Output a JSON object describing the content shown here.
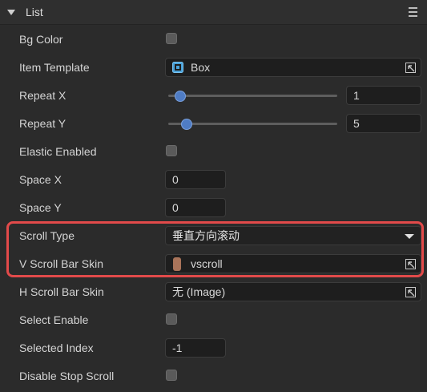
{
  "panel": {
    "title": "List"
  },
  "rows": {
    "bg_color": {
      "label": "Bg Color"
    },
    "item_template": {
      "label": "Item Template",
      "value": "Box"
    },
    "repeat_x": {
      "label": "Repeat X",
      "value": "1",
      "slider_level": 0.05
    },
    "repeat_y": {
      "label": "Repeat Y",
      "value": "5",
      "slider_level": 0.09
    },
    "elastic_enabled": {
      "label": "Elastic Enabled"
    },
    "space_x": {
      "label": "Space X",
      "value": "0"
    },
    "space_y": {
      "label": "Space Y",
      "value": "0"
    },
    "scroll_type": {
      "label": "Scroll Type",
      "value": "垂直方向滚动"
    },
    "v_scroll_bar_skin": {
      "label": "V Scroll Bar Skin",
      "value": "vscroll"
    },
    "h_scroll_bar_skin": {
      "label": "H Scroll Bar Skin",
      "value": "无 (Image)"
    },
    "select_enable": {
      "label": "Select Enable"
    },
    "selected_index": {
      "label": "Selected Index",
      "value": "-1"
    },
    "disable_stop_scroll": {
      "label": "Disable Stop Scroll"
    }
  },
  "colors": {
    "panel_bg": "#2b2b2b",
    "slider_thumb": "#4f7cc4",
    "highlight_border": "#e24a4a",
    "vscroll_swatch": "#a9745a"
  },
  "icons": {
    "collapse": "caret-down-icon",
    "menu": "hamburger-menu-icon",
    "picker": "pick-arrow-icon",
    "template": "box-component-icon"
  }
}
